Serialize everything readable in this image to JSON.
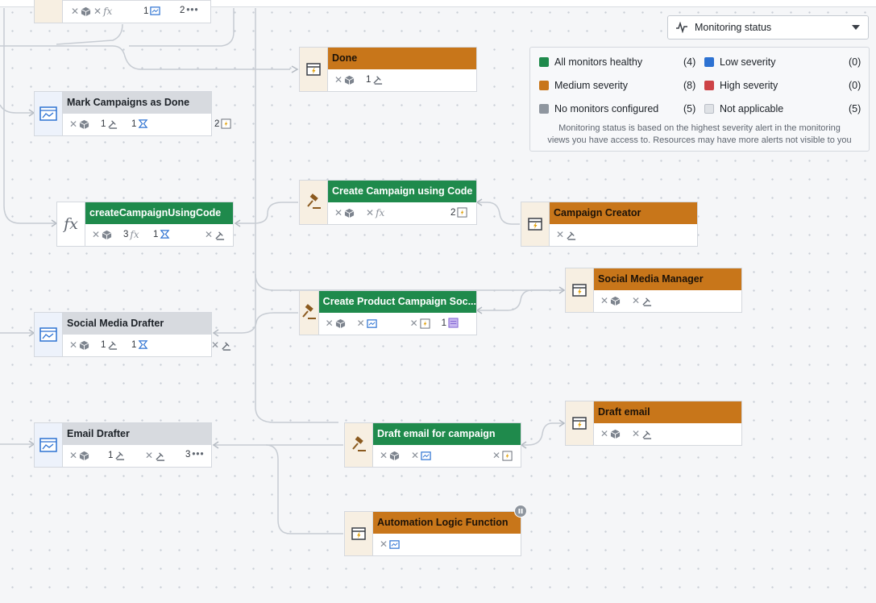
{
  "monitoring": {
    "dropdown_label": "Monitoring status",
    "legend": [
      {
        "label": "All monitors healthy",
        "count": "(4)",
        "color": "#1f8a4c"
      },
      {
        "label": "Low severity",
        "count": "(0)",
        "color": "#2d72d2"
      },
      {
        "label": "Medium severity",
        "count": "(8)",
        "color": "#c8761a"
      },
      {
        "label": "High severity",
        "count": "(0)",
        "color": "#cd4246"
      },
      {
        "label": "No monitors configured",
        "count": "(5)",
        "color": "#8f969f"
      },
      {
        "label": "Not applicable",
        "count": "(5)",
        "color": "#dfe2e6"
      }
    ],
    "note_line1": "Monitoring status is based on the highest severity alert in the monitoring",
    "note_line2": "views you have access to. Resources may have more alerts not visible to you"
  },
  "nodes": {
    "top_partial": {
      "count1": "1",
      "count2": "2",
      "more": "•••"
    },
    "done": {
      "title": "Done",
      "count1": "1"
    },
    "mark_campaigns": {
      "title": "Mark Campaigns as Done",
      "count1": "1",
      "count2": "1",
      "count3": "2"
    },
    "create_campaign_code": {
      "title": "Create Campaign using Code",
      "count1": "2"
    },
    "campaign_creator": {
      "title": "Campaign Creator"
    },
    "create_campaign_fn": {
      "title": "createCampaignUsingCode",
      "count1": "3",
      "count2": "1"
    },
    "social_media_manager": {
      "title": "Social Media Manager"
    },
    "create_product_campaign": {
      "title": "Create Product Campaign Soc...",
      "count1": "1"
    },
    "social_media_drafter": {
      "title": "Social Media Drafter",
      "count1": "1",
      "count2": "1"
    },
    "draft_email": {
      "title": "Draft email"
    },
    "draft_email_campaign": {
      "title": "Draft email for campaign"
    },
    "email_drafter": {
      "title": "Email Drafter",
      "count1": "1",
      "count2": "3",
      "more": "•••"
    },
    "automation_logic": {
      "title": "Automation Logic Function"
    }
  }
}
